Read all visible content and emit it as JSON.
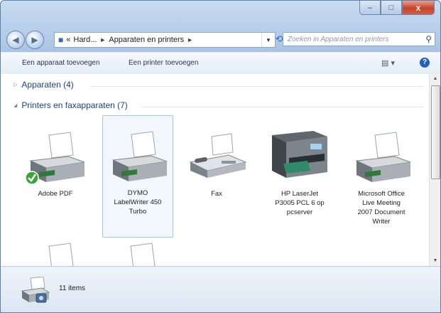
{
  "window": {
    "controls": {
      "minimize": "–",
      "maximize": "□",
      "close": "x"
    }
  },
  "navbar": {
    "back_icon": "back-arrow-icon",
    "forward_icon": "forward-arrow-icon",
    "breadcrumb_prefix": "«",
    "crumbs": [
      "Hard...",
      "Apparaten en printers"
    ],
    "separator": "►",
    "search_placeholder": "Zoeken in Apparaten en printers"
  },
  "toolbar": {
    "add_device": "Een apparaat toevoegen",
    "add_printer": "Een printer toevoegen",
    "view_icon": "views-icon",
    "help_icon": "help-icon",
    "help_label": "?"
  },
  "groups": {
    "devices": "Apparaten (4)",
    "printers": "Printers en faxapparaten (7)"
  },
  "printers": [
    {
      "label": "Adobe PDF",
      "icon": "printer-icon",
      "default": true
    },
    {
      "label": "DYMO\nLabelWriter 450\nTurbo",
      "icon": "printer-icon",
      "selected": true
    },
    {
      "label": "Fax",
      "icon": "fax-icon"
    },
    {
      "label": "HP LaserJet\nP3005 PCL 6 op\npcserver",
      "icon": "multifunction-printer-icon"
    },
    {
      "label": "Microsoft Office\nLive Meeting\n2007 Document\nWriter",
      "icon": "printer-icon"
    },
    {
      "label": "",
      "icon": "printer-icon"
    },
    {
      "label": "",
      "icon": "printer-icon"
    }
  ],
  "status": {
    "icon": "devices-and-printers-icon",
    "count": "11 items"
  },
  "colors": {
    "link": "#1c3f94",
    "selection": "#a4c3e6"
  }
}
